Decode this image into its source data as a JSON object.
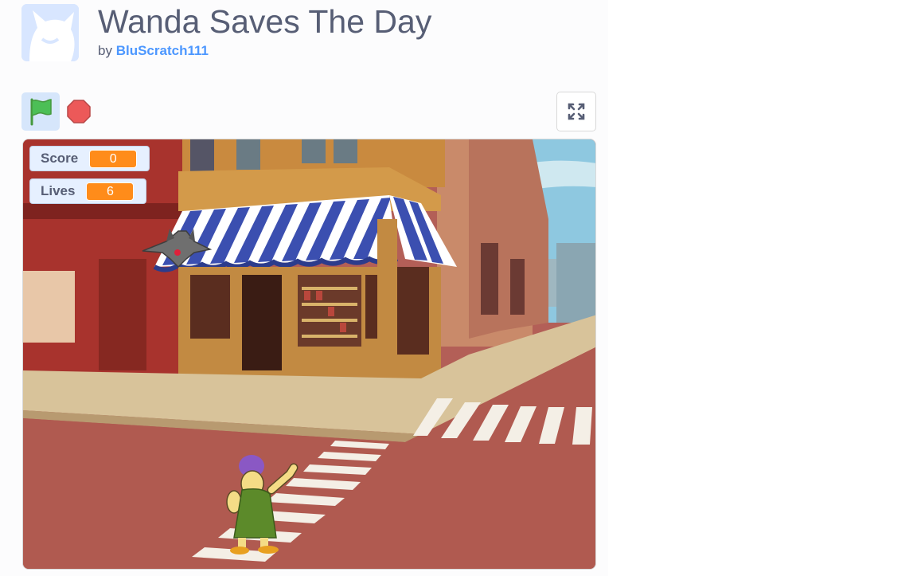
{
  "project": {
    "title": "Wanda Saves The Day",
    "by_prefix": "by",
    "author": "BluScratch111"
  },
  "controls": {
    "green_flag_icon": "green-flag-icon",
    "stop_icon": "stop-sign-icon",
    "fullscreen_icon": "fullscreen-expand-icon"
  },
  "stage": {
    "monitors": [
      {
        "label": "Score",
        "value": "0"
      },
      {
        "label": "Lives",
        "value": "6"
      }
    ],
    "sprites": [
      "bat",
      "wanda"
    ],
    "backdrop": "city-street-shop-corner"
  },
  "colors": {
    "accent": "#4c97ff",
    "monitor_value": "#ff8c1a",
    "text": "#575e75"
  }
}
